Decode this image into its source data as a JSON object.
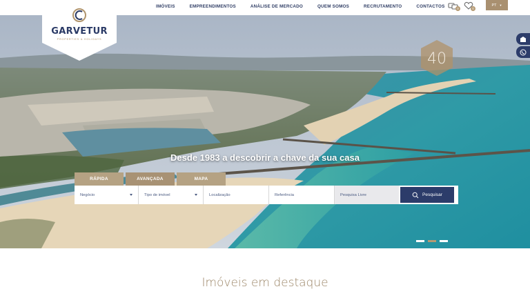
{
  "nav": {
    "items": [
      "IMÓVEIS",
      "EMPREENDIMENTOS",
      "ANÁLISE DE MERCADO",
      "QUEM SOMOS",
      "RECRUTAMENTO",
      "CONTACTOS"
    ],
    "lang": "PT",
    "favorites_count": "0"
  },
  "logo": {
    "name": "GARVETUR",
    "tagline": "PROPERTIES & HOLIDAYS"
  },
  "emblem": {
    "text": "40"
  },
  "hero": {
    "tagline": "Desde 1983 a descobrir a chave da sua casa",
    "slides_total": 3,
    "active_slide": 2
  },
  "search": {
    "tabs": [
      "RÁPIDA",
      "AVANÇADA",
      "MAPA"
    ],
    "negocio": "Negócio",
    "tipo": "Tipo de imóvel",
    "localizacao": "Localização",
    "referencia": "Referência",
    "livre": "Pesquisa Livre",
    "button": "Pesquisar"
  },
  "featured": {
    "title": "Imóveis em destaque"
  },
  "colors": {
    "navy": "#2c3c6a",
    "gold": "#b59a73",
    "tab": "#b5a283"
  }
}
